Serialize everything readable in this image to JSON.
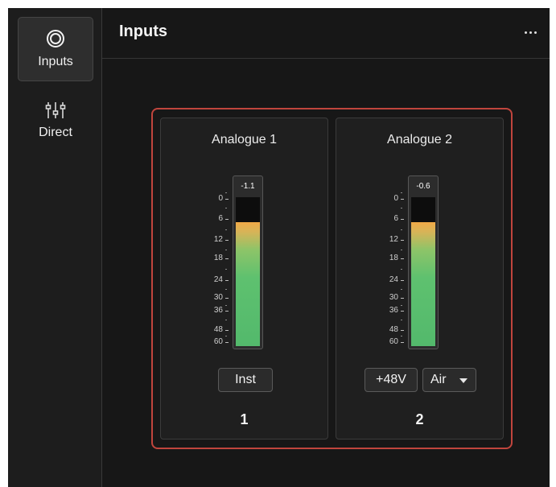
{
  "sidebar": {
    "items": [
      {
        "label": "Inputs",
        "icon": "inputs-icon",
        "active": true
      },
      {
        "label": "Direct",
        "icon": "mixer-sliders-icon",
        "active": false
      }
    ]
  },
  "header": {
    "title": "Inputs",
    "more_icon": "more-horizontal-icon"
  },
  "colors": {
    "group_outline": "#c0453d",
    "meter_green": "#5ec16f",
    "meter_orange": "#f0a947",
    "background": "#171717"
  },
  "meter_scale": [
    "0",
    "6",
    "12",
    "18",
    "24",
    "30",
    "36",
    "48",
    "60"
  ],
  "channels": [
    {
      "name": "Analogue 1",
      "peak": "-1.1",
      "level": 0.83,
      "buttons": [
        {
          "label": "Inst",
          "type": "toggle"
        }
      ],
      "number": "1"
    },
    {
      "name": "Analogue 2",
      "peak": "-0.6",
      "level": 0.83,
      "buttons": [
        {
          "label": "+48V",
          "type": "toggle"
        },
        {
          "label": "Air",
          "type": "dropdown"
        }
      ],
      "number": "2"
    }
  ]
}
